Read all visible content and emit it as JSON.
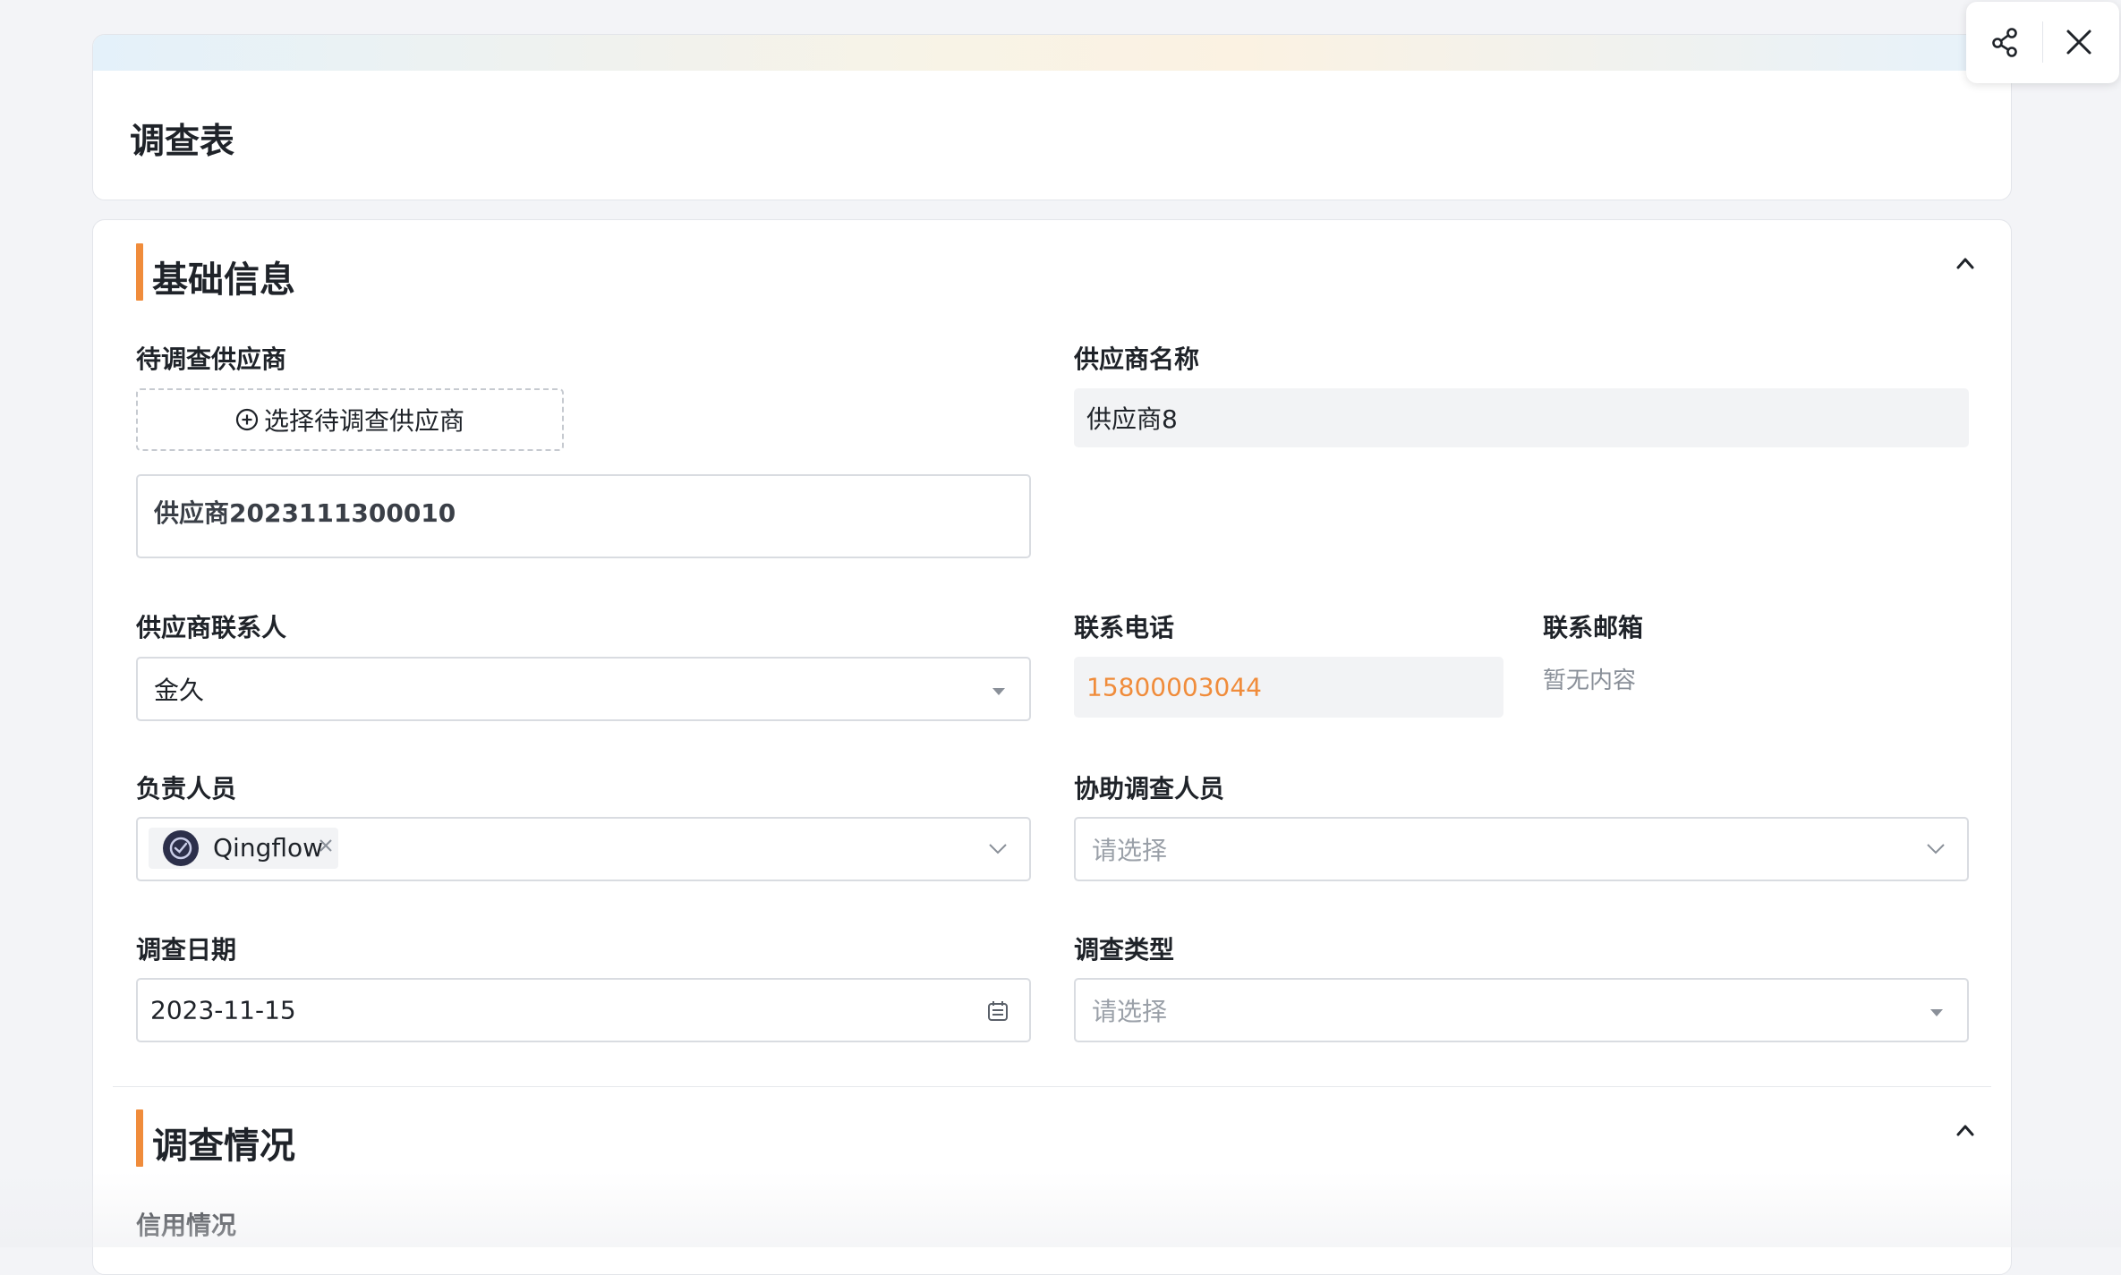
{
  "page": {
    "title": "调查表"
  },
  "toolbar": {
    "share_icon": "share-icon",
    "close_icon": "close-icon"
  },
  "sections": {
    "basic": {
      "title": "基础信息",
      "fields": {
        "supplier_select": {
          "label": "待调查供应商",
          "button_label": "选择待调查供应商",
          "selected_value": "供应商2023111300010"
        },
        "supplier_name": {
          "label": "供应商名称",
          "value": "供应商8"
        },
        "contact": {
          "label": "供应商联系人",
          "value": "金久"
        },
        "phone": {
          "label": "联系电话",
          "value": "15800003044"
        },
        "email": {
          "label": "联系邮箱",
          "value": "暂无内容"
        },
        "owner": {
          "label": "负责人员",
          "chip_name": "Qingflow"
        },
        "assistants": {
          "label": "协助调查人员",
          "placeholder": "请选择"
        },
        "survey_date": {
          "label": "调查日期",
          "value": "2023-11-15"
        },
        "survey_type": {
          "label": "调查类型",
          "placeholder": "请选择"
        }
      }
    },
    "survey": {
      "title": "调查情况",
      "fields": {
        "credit": {
          "label": "信用情况"
        }
      }
    }
  },
  "colors": {
    "accent": "#f08c3b",
    "phone_text": "#f08c3b",
    "border": "#d9dce1",
    "readonly_bg": "#f2f3f5"
  }
}
